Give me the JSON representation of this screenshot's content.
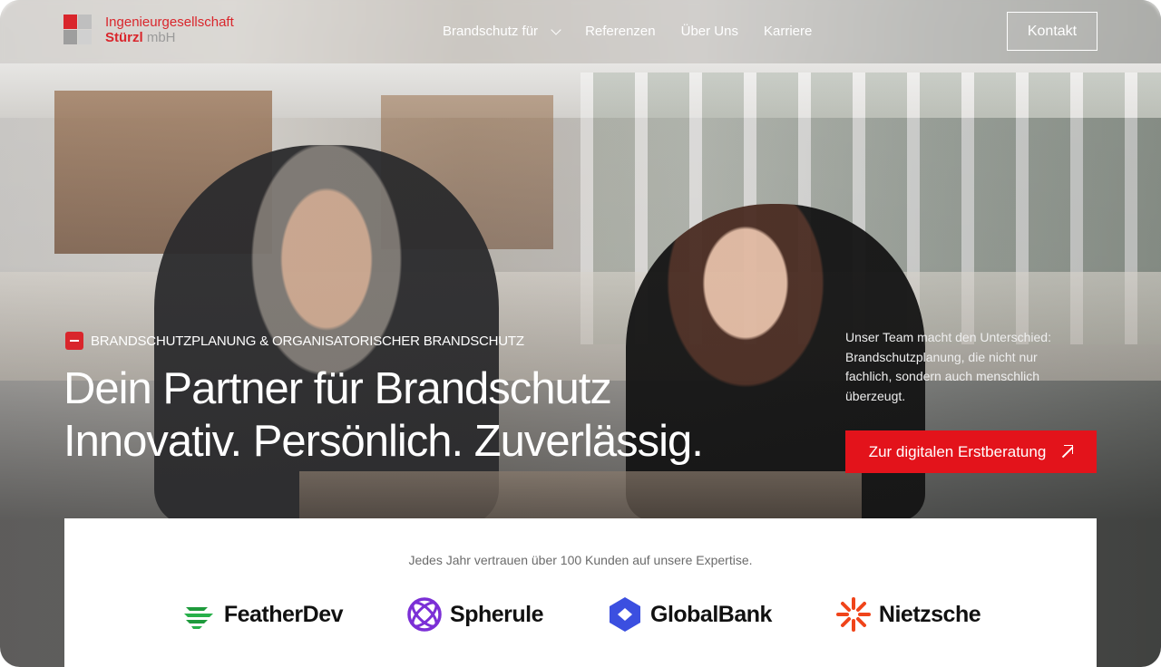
{
  "header": {
    "logo_line1": "Ingenieurgesellschaft",
    "logo_line2_bold": "Stürzl",
    "logo_line2_light": "mbH",
    "nav": [
      {
        "label": "Brandschutz für",
        "has_dropdown": true
      },
      {
        "label": "Referenzen"
      },
      {
        "label": "Über Uns"
      },
      {
        "label": "Karriere"
      }
    ],
    "contact_label": "Kontakt"
  },
  "hero": {
    "eyebrow": "BRANDSCHUTZPLANUNG & ORGANISATORISCHER BRANDSCHUTZ",
    "headline_line1": "Dein Partner für Brandschutz",
    "headline_line2": "Innovativ. Persönlich. Zuverlässig.",
    "side_text": "Unser Team macht den Unterschied: Brandschutzplanung, die nicht nur fachlich, sondern auch menschlich überzeugt.",
    "cta_label": "Zur digitalen Erstberatung",
    "cta_icon": "arrow-up-right-icon"
  },
  "trust": {
    "text": "Jedes Jahr vertrauen über 100 Kunden auf unsere Expertise.",
    "brands": [
      {
        "name": "FeatherDev",
        "icon": "feather-dev-logo-icon",
        "color": "#1e9a3c"
      },
      {
        "name": "Spherule",
        "icon": "spherule-logo-icon",
        "color": "#7b2fd6"
      },
      {
        "name": "GlobalBank",
        "icon": "globalbank-logo-icon",
        "color": "#3b4fe0"
      },
      {
        "name": "Nietzsche",
        "icon": "nietzsche-logo-icon",
        "color": "#f0441a"
      }
    ]
  },
  "colors": {
    "accent": "#e3131b",
    "brand_red": "#d9262c"
  }
}
